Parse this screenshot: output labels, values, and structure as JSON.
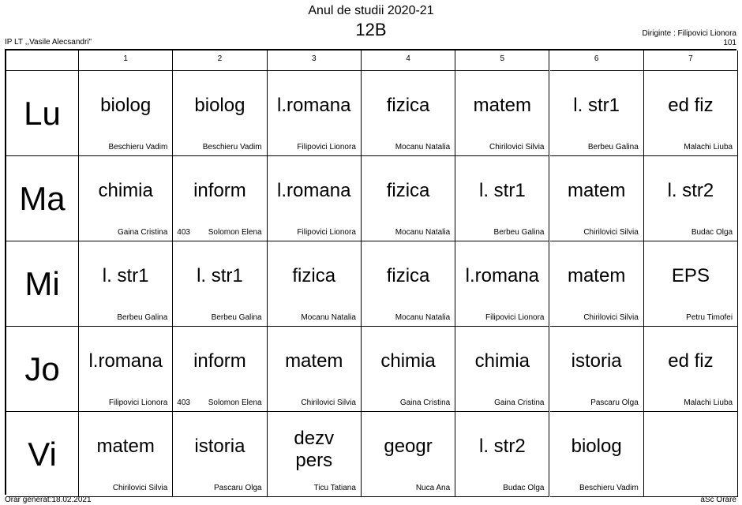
{
  "header": {
    "title": "Anul de studii 2020-21",
    "class_name": "12B",
    "school": "IP LT ,,Vasile Alecsandri\"",
    "diriginte": "Diriginte : Filipovici Lionora",
    "room": "101"
  },
  "periods": [
    "1",
    "2",
    "3",
    "4",
    "5",
    "6",
    "7"
  ],
  "days": [
    {
      "label": "Lu",
      "lessons": [
        {
          "subject": "biolog",
          "teacher": "Beschieru Vadim",
          "room": ""
        },
        {
          "subject": "biolog",
          "teacher": "Beschieru Vadim",
          "room": ""
        },
        {
          "subject": "l.romana",
          "teacher": "Filipovici Lionora",
          "room": ""
        },
        {
          "subject": "fizica",
          "teacher": "Mocanu Natalia",
          "room": ""
        },
        {
          "subject": "matem",
          "teacher": "Chirilovici Silvia",
          "room": ""
        },
        {
          "subject": "l. str1",
          "teacher": "Berbeu Galina",
          "room": ""
        },
        {
          "subject": "ed fiz",
          "teacher": "Malachi Liuba",
          "room": ""
        }
      ]
    },
    {
      "label": "Ma",
      "lessons": [
        {
          "subject": "chimia",
          "teacher": "Gaina Cristina",
          "room": ""
        },
        {
          "subject": "inform",
          "teacher": "Solomon Elena",
          "room": "403"
        },
        {
          "subject": "l.romana",
          "teacher": "Filipovici Lionora",
          "room": ""
        },
        {
          "subject": "fizica",
          "teacher": "Mocanu Natalia",
          "room": ""
        },
        {
          "subject": "l. str1",
          "teacher": "Berbeu Galina",
          "room": ""
        },
        {
          "subject": "matem",
          "teacher": "Chirilovici Silvia",
          "room": ""
        },
        {
          "subject": "l. str2",
          "teacher": "Budac Olga",
          "room": ""
        }
      ]
    },
    {
      "label": "Mi",
      "lessons": [
        {
          "subject": "l. str1",
          "teacher": "Berbeu Galina",
          "room": ""
        },
        {
          "subject": "l. str1",
          "teacher": "Berbeu Galina",
          "room": ""
        },
        {
          "subject": "fizica",
          "teacher": "Mocanu Natalia",
          "room": ""
        },
        {
          "subject": "fizica",
          "teacher": "Mocanu Natalia",
          "room": ""
        },
        {
          "subject": "l.romana",
          "teacher": "Filipovici Lionora",
          "room": ""
        },
        {
          "subject": "matem",
          "teacher": "Chirilovici Silvia",
          "room": ""
        },
        {
          "subject": "EPS",
          "teacher": "Petru Timofei",
          "room": ""
        }
      ]
    },
    {
      "label": "Jo",
      "lessons": [
        {
          "subject": "l.romana",
          "teacher": "Filipovici Lionora",
          "room": ""
        },
        {
          "subject": "inform",
          "teacher": "Solomon Elena",
          "room": "403"
        },
        {
          "subject": "matem",
          "teacher": "Chirilovici Silvia",
          "room": ""
        },
        {
          "subject": "chimia",
          "teacher": "Gaina Cristina",
          "room": ""
        },
        {
          "subject": "chimia",
          "teacher": "Gaina Cristina",
          "room": ""
        },
        {
          "subject": "istoria",
          "teacher": "Pascaru Olga",
          "room": ""
        },
        {
          "subject": "ed fiz",
          "teacher": "Malachi Liuba",
          "room": ""
        }
      ]
    },
    {
      "label": "Vi",
      "lessons": [
        {
          "subject": "matem",
          "teacher": "Chirilovici Silvia",
          "room": ""
        },
        {
          "subject": "istoria",
          "teacher": "Pascaru Olga",
          "room": ""
        },
        {
          "subject": "dezv pers",
          "teacher": "Ticu Tatiana",
          "room": ""
        },
        {
          "subject": "geogr",
          "teacher": "Nuca Ana",
          "room": ""
        },
        {
          "subject": "l. str2",
          "teacher": "Budac Olga",
          "room": ""
        },
        {
          "subject": "biolog",
          "teacher": "Beschieru Vadim",
          "room": ""
        },
        {
          "subject": "",
          "teacher": "",
          "room": ""
        }
      ]
    }
  ],
  "footer": {
    "left": "Orar generat:18.02.2021",
    "right": "aSc Orare"
  }
}
